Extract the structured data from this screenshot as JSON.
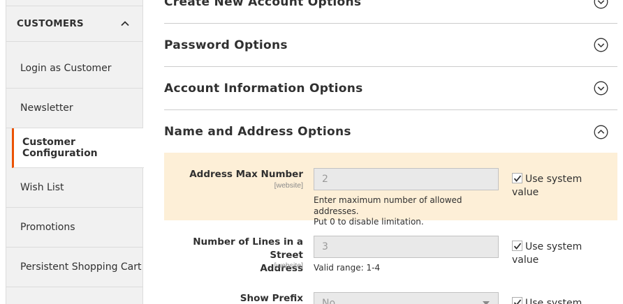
{
  "sidebar": {
    "title": "CUSTOMERS",
    "items": [
      {
        "label": "Login as Customer"
      },
      {
        "label": "Newsletter"
      },
      {
        "label": "Customer Configuration",
        "active": true
      },
      {
        "label": "Wish List"
      },
      {
        "label": "Promotions"
      },
      {
        "label": "Persistent Shopping Cart"
      }
    ]
  },
  "sections": [
    {
      "title": "Create New Account Options",
      "state": "collapsed"
    },
    {
      "title": "Password Options",
      "state": "collapsed"
    },
    {
      "title": "Account Information Options",
      "state": "collapsed"
    },
    {
      "title": "Name and Address Options",
      "state": "expanded"
    }
  ],
  "fields": {
    "address_max": {
      "label": "Address Max Number",
      "scope": "[website]",
      "value": "2",
      "note_line1": "Enter maximum number of allowed addresses.",
      "note_line2": "Put 0 to disable limitation.",
      "use_system_line1": "Use system",
      "use_system_line2": "value",
      "checked": true
    },
    "street_lines": {
      "label_line1": "Number of Lines in a Street",
      "label_line2": "Address",
      "scope": "[website]",
      "value": "3",
      "note": "Valid range: 1-4",
      "use_system_line1": "Use system",
      "use_system_line2": "value",
      "checked": true
    },
    "show_prefix": {
      "label": "Show Prefix",
      "value": "No",
      "use_system_line1": "Use system",
      "checked": true
    }
  },
  "colors": {
    "accent": "#eb5202",
    "highlight_row": "#fdefd7"
  }
}
